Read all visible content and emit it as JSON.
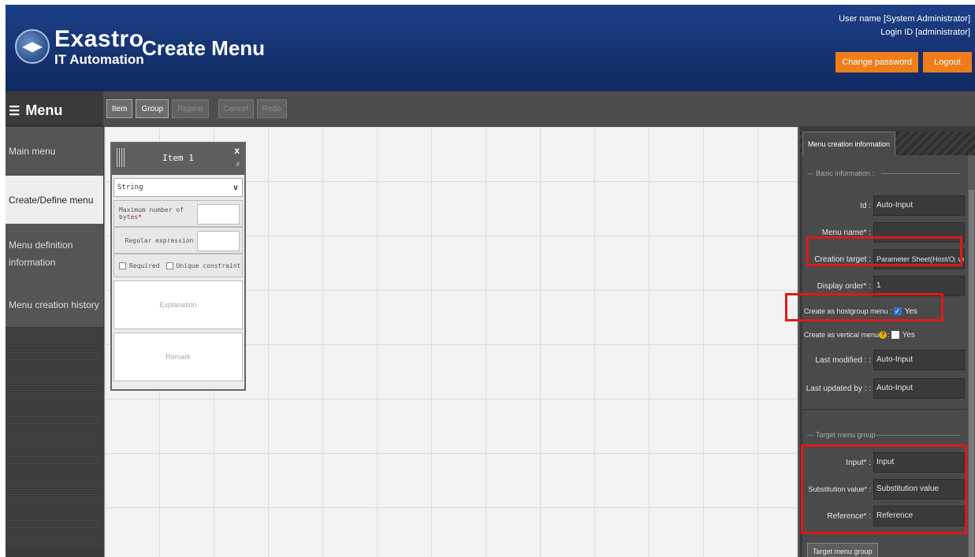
{
  "header": {
    "brand_name": "Exastro",
    "brand_sub": "IT Automation",
    "page_title": "Create Menu",
    "user_name": "User name [System Administrator]",
    "login_id": "Login ID [administrator]",
    "change_password_label": "Change password",
    "logout_label": "Logout",
    "accent_color": "#ef7d1a",
    "header_color": "#1c3f86"
  },
  "menu_bar": {
    "icon": "hamburger-icon",
    "label": "Menu"
  },
  "toolbar": {
    "item": "Item",
    "group": "Group",
    "repeat": "Repeat",
    "cancel": "Cancel",
    "redo": "Redo"
  },
  "sidebar": {
    "items": [
      {
        "label": "Main menu"
      },
      {
        "label": "Create/Define menu"
      },
      {
        "label": "Menu definition information"
      },
      {
        "label": "Menu creation history"
      }
    ]
  },
  "item_card": {
    "title": "Item 1",
    "close": "x",
    "hash": "#",
    "type_value": "String",
    "max_bytes_label": "Maximum number of bytes",
    "required_mark": "*",
    "regex_label": "Regular expression",
    "required_label": "Required",
    "unique_label": "Unique constraint",
    "explanation_placeholder": "Explanation",
    "remark_placeholder": "Remark"
  },
  "panel": {
    "tab": "Menu creation information",
    "basic_info_title": "Basic information :",
    "fields": {
      "id_label": "Id :",
      "id_value": "Auto-Input",
      "menu_name_label": "Menu name* :",
      "menu_name_value": "",
      "creation_target_label": "Creation target :",
      "creation_target_value": "Parameter Sheet(Host/Operat",
      "display_order_label": "Display order* :",
      "display_order_value": "1",
      "hostgroup_label": "Create as hostgroup menu :",
      "hostgroup_value": "Yes",
      "vertical_label": "Create as vertical menu",
      "vertical_value": "Yes",
      "last_modified_label": "Last modified : :",
      "last_modified_value": "Auto-Input",
      "last_updated_label": "Last updated by : :",
      "last_updated_value": "Auto-Input"
    },
    "target_group_title": "Target menu group",
    "target_fields": {
      "input_label": "Input* :",
      "input_value": "Input",
      "substitution_label": "Substitution value* :",
      "substitution_value": "Substitution value",
      "reference_label": "Reference* :",
      "reference_value": "Reference"
    },
    "target_menu_group_button": "Target menu group"
  }
}
